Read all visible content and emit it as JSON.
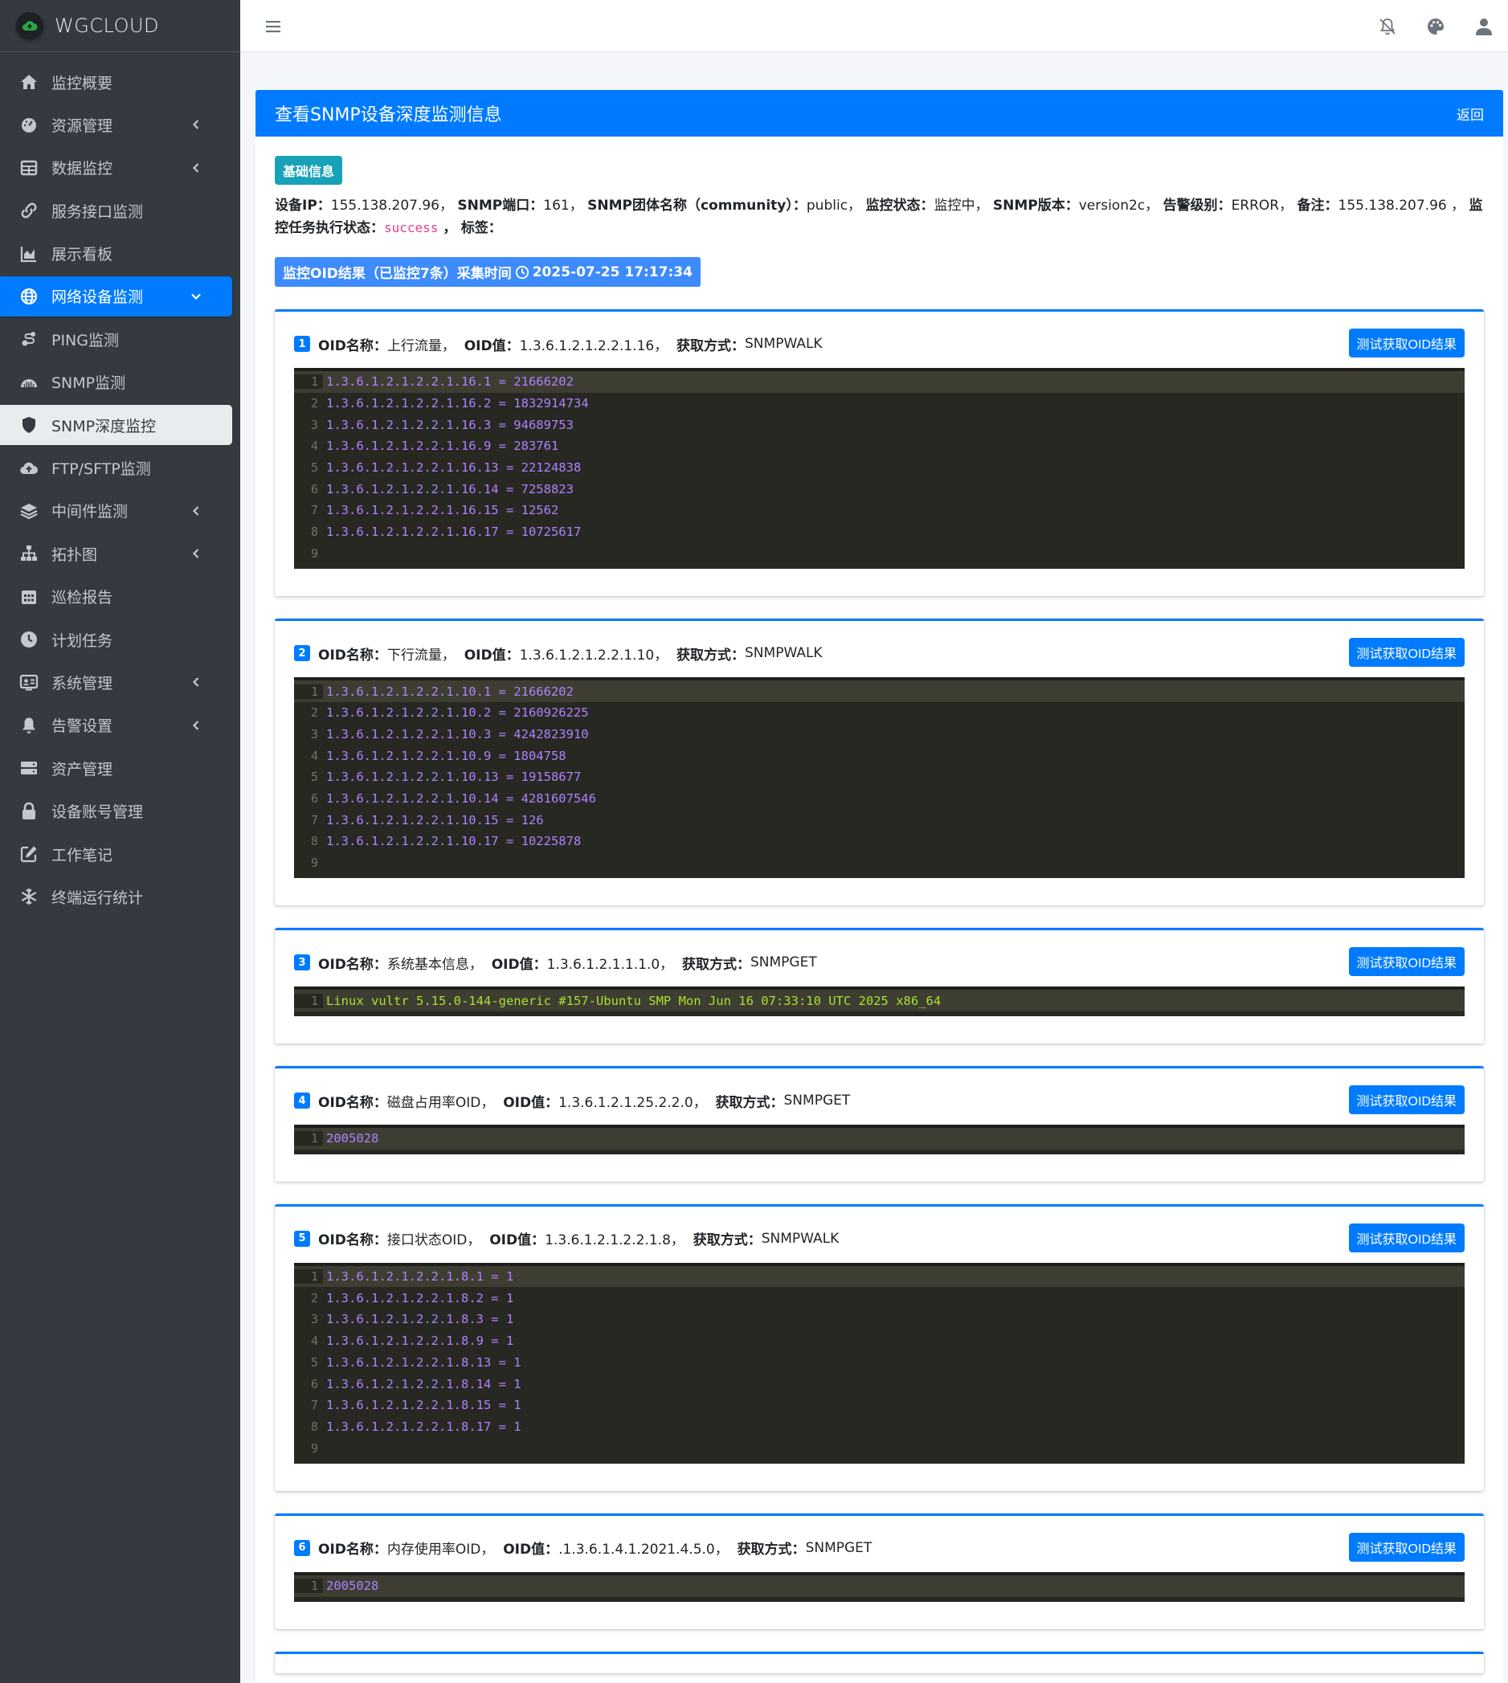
{
  "brand": {
    "name": "WGCLOUD"
  },
  "sidebar": {
    "items": [
      {
        "label": "监控概要",
        "icon": "home-icon",
        "chevron": false
      },
      {
        "label": "资源管理",
        "icon": "tachometer-icon",
        "chevron": true
      },
      {
        "label": "数据监控",
        "icon": "table-icon",
        "chevron": true
      },
      {
        "label": "服务接口监测",
        "icon": "link-icon",
        "chevron": false
      },
      {
        "label": "展示看板",
        "icon": "area-chart-icon",
        "chevron": false
      },
      {
        "label": "网络设备监测",
        "icon": "globe-icon",
        "chevron": true
      },
      {
        "label": "PING监测",
        "icon": "ping-icon",
        "chevron": false
      },
      {
        "label": "SNMP监测",
        "icon": "snmp-icon",
        "chevron": false
      },
      {
        "label": "SNMP深度监控",
        "icon": "shield-icon",
        "chevron": false
      },
      {
        "label": "FTP/SFTP监测",
        "icon": "cloud-upload-icon",
        "chevron": false
      },
      {
        "label": "中间件监测",
        "icon": "layers-icon",
        "chevron": true
      },
      {
        "label": "拓扑图",
        "icon": "sitemap-icon",
        "chevron": true
      },
      {
        "label": "巡检报告",
        "icon": "calendar-icon",
        "chevron": false
      },
      {
        "label": "计划任务",
        "icon": "clock-icon",
        "chevron": false
      },
      {
        "label": "系统管理",
        "icon": "id-card-icon",
        "chevron": true
      },
      {
        "label": "告警设置",
        "icon": "bell-icon",
        "chevron": true
      },
      {
        "label": "资产管理",
        "icon": "server-icon",
        "chevron": false
      },
      {
        "label": "设备账号管理",
        "icon": "lock-icon",
        "chevron": false
      },
      {
        "label": "工作笔记",
        "icon": "edit-icon",
        "chevron": false
      },
      {
        "label": "终端运行统计",
        "icon": "snowflake-icon",
        "chevron": false
      }
    ]
  },
  "header": {
    "title": "查看SNMP设备深度监测信息",
    "back": "返回"
  },
  "basic": {
    "badge": "基础信息",
    "ip_label": "设备IP：",
    "ip": "155.138.207.96，",
    "port_label": "SNMP端口：",
    "port": "161，",
    "community_label": "SNMP团体名称（community）：",
    "community": "public，",
    "status_label": "监控状态：",
    "status": "监控中，",
    "version_label": "SNMP版本：",
    "version": "version2c，",
    "level_label": "告警级别：",
    "level": "ERROR，",
    "remark_label": "备注：",
    "remark": "155.138.207.96 ，",
    "task_label": "监控任务执行状态：",
    "task": "success",
    "tag_sep": " ，",
    "tag_label": "标签："
  },
  "result": {
    "label": "监控OID结果（已监控7条）采集时间",
    "time": "2025-07-25 17:17:34"
  },
  "labels": {
    "name": "OID名称：",
    "value": "OID值：",
    "method": "获取方式：",
    "test_button": "测试获取OID结果"
  },
  "oids": [
    {
      "num": "1",
      "name": "上行流量，",
      "oid": "1.3.6.1.2.1.2.2.1.16，",
      "method": "SNMPWALK",
      "lines": [
        "1.3.6.1.2.1.2.2.1.16.1 = 21666202",
        "1.3.6.1.2.1.2.2.1.16.2 = 1832914734",
        "1.3.6.1.2.1.2.2.1.16.3 = 94689753",
        "1.3.6.1.2.1.2.2.1.16.9 = 283761",
        "1.3.6.1.2.1.2.2.1.16.13 = 22124838",
        "1.3.6.1.2.1.2.2.1.16.14 = 7258823",
        "1.3.6.1.2.1.2.2.1.16.15 = 12562",
        "1.3.6.1.2.1.2.2.1.16.17 = 10725617",
        ""
      ]
    },
    {
      "num": "2",
      "name": "下行流量，",
      "oid": "1.3.6.1.2.1.2.2.1.10，",
      "method": "SNMPWALK",
      "lines": [
        "1.3.6.1.2.1.2.2.1.10.1 = 21666202",
        "1.3.6.1.2.1.2.2.1.10.2 = 2160926225",
        "1.3.6.1.2.1.2.2.1.10.3 = 4242823910",
        "1.3.6.1.2.1.2.2.1.10.9 = 1804758",
        "1.3.6.1.2.1.2.2.1.10.13 = 19158677",
        "1.3.6.1.2.1.2.2.1.10.14 = 4281607546",
        "1.3.6.1.2.1.2.2.1.10.15 = 126",
        "1.3.6.1.2.1.2.2.1.10.17 = 10225878",
        ""
      ]
    },
    {
      "num": "3",
      "name": "系统基本信息，",
      "oid": "1.3.6.1.2.1.1.1.0，",
      "method": "SNMPGET",
      "lines": [
        "Linux vultr 5.15.0-144-generic #157-Ubuntu SMP Mon Jun 16 07:33:10 UTC 2025 x86_64"
      ]
    },
    {
      "num": "4",
      "name": "磁盘占用率OID，",
      "oid": "1.3.6.1.2.1.25.2.2.0，",
      "method": "SNMPGET",
      "lines": [
        "2005028"
      ]
    },
    {
      "num": "5",
      "name": "接口状态OID，",
      "oid": "1.3.6.1.2.1.2.2.1.8，",
      "method": "SNMPWALK",
      "lines": [
        "1.3.6.1.2.1.2.2.1.8.1 = 1",
        "1.3.6.1.2.1.2.2.1.8.2 = 1",
        "1.3.6.1.2.1.2.2.1.8.3 = 1",
        "1.3.6.1.2.1.2.2.1.8.9 = 1",
        "1.3.6.1.2.1.2.2.1.8.13 = 1",
        "1.3.6.1.2.1.2.2.1.8.14 = 1",
        "1.3.6.1.2.1.2.2.1.8.15 = 1",
        "1.3.6.1.2.1.2.2.1.8.17 = 1",
        ""
      ]
    },
    {
      "num": "6",
      "name": "内存使用率OID，",
      "oid": ".1.3.6.1.4.1.2021.4.5.0，",
      "method": "SNMPGET",
      "lines": [
        "2005028"
      ]
    }
  ],
  "colors": {
    "primary": "#007bff",
    "sidebar": "#343a40",
    "info": "#17a2b8",
    "code_bg": "#272822",
    "code_number": "#ae81ff",
    "code_green": "#a6e22e"
  }
}
